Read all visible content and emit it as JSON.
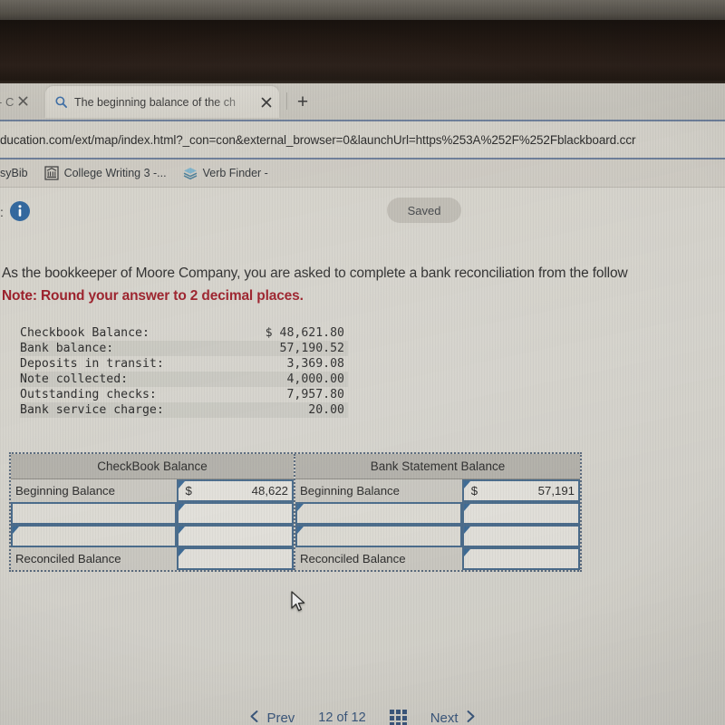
{
  "browser": {
    "prev_tab": {
      "label": "- C",
      "close_icon": "close-icon"
    },
    "active_tab": {
      "icon": "search-icon",
      "title": "The beginning balance of the ch",
      "close_icon": "close-icon"
    },
    "new_tab_label": "+",
    "omnibox": {
      "url": "ducation.com/ext/map/index.html?_con=con&external_browser=0&launchUrl=https%253A%252F%252Fblackboard.ccr"
    },
    "bookmarks": [
      {
        "label": "syBib",
        "icon": ""
      },
      {
        "label": "College Writing 3 -...",
        "icon": "bank-icon"
      },
      {
        "label": "Verb Finder -",
        "icon": "layers-icon"
      }
    ]
  },
  "app": {
    "info_icon": "info-icon",
    "left_glyph": ":",
    "saved_label": "Saved"
  },
  "question": {
    "prompt": "As the bookkeeper of Moore Company, you are asked to complete a bank reconciliation from the follow",
    "note": "Note: Round your answer to 2 decimal places."
  },
  "given_data": {
    "rows": [
      {
        "label": "Checkbook Balance:",
        "amount": "$ 48,621.80"
      },
      {
        "label": "Bank balance:",
        "amount": "57,190.52"
      },
      {
        "label": "Deposits in transit:",
        "amount": "3,369.08"
      },
      {
        "label": "Note collected:",
        "amount": "4,000.00"
      },
      {
        "label": "Outstanding checks:",
        "amount": "7,957.80"
      },
      {
        "label": "Bank service charge:",
        "amount": "20.00"
      }
    ]
  },
  "reconciliation": {
    "left": {
      "header": "CheckBook Balance",
      "rows": [
        {
          "label": "Beginning Balance",
          "currency": "$",
          "value": "48,622",
          "label_is_input": false
        },
        {
          "label": "",
          "currency": "",
          "value": "",
          "label_is_input": true
        },
        {
          "label": "",
          "currency": "",
          "value": "",
          "label_is_input": true
        },
        {
          "label": "Reconciled Balance",
          "currency": "",
          "value": "",
          "label_is_input": false
        }
      ]
    },
    "right": {
      "header": "Bank Statement Balance",
      "rows": [
        {
          "label": "Beginning Balance",
          "currency": "$",
          "value": "57,191",
          "label_is_input": false
        },
        {
          "label": "",
          "currency": "",
          "value": "",
          "label_is_input": true
        },
        {
          "label": "",
          "currency": "",
          "value": "",
          "label_is_input": true
        },
        {
          "label": "Reconciled Balance",
          "currency": "",
          "value": "",
          "label_is_input": false
        }
      ]
    }
  },
  "bottom_nav": {
    "prev_label": "Prev",
    "prev_icon": "chevron-left-icon",
    "counter": "12 of 12",
    "grid_icon": "grid-icon",
    "next_label": "Next",
    "next_icon": "chevron-right-icon"
  },
  "colors": {
    "accent_blue": "#3d5a80",
    "note_red": "#9c1d28",
    "input_border": "#4a6c8c",
    "info_blue": "#31679f"
  }
}
